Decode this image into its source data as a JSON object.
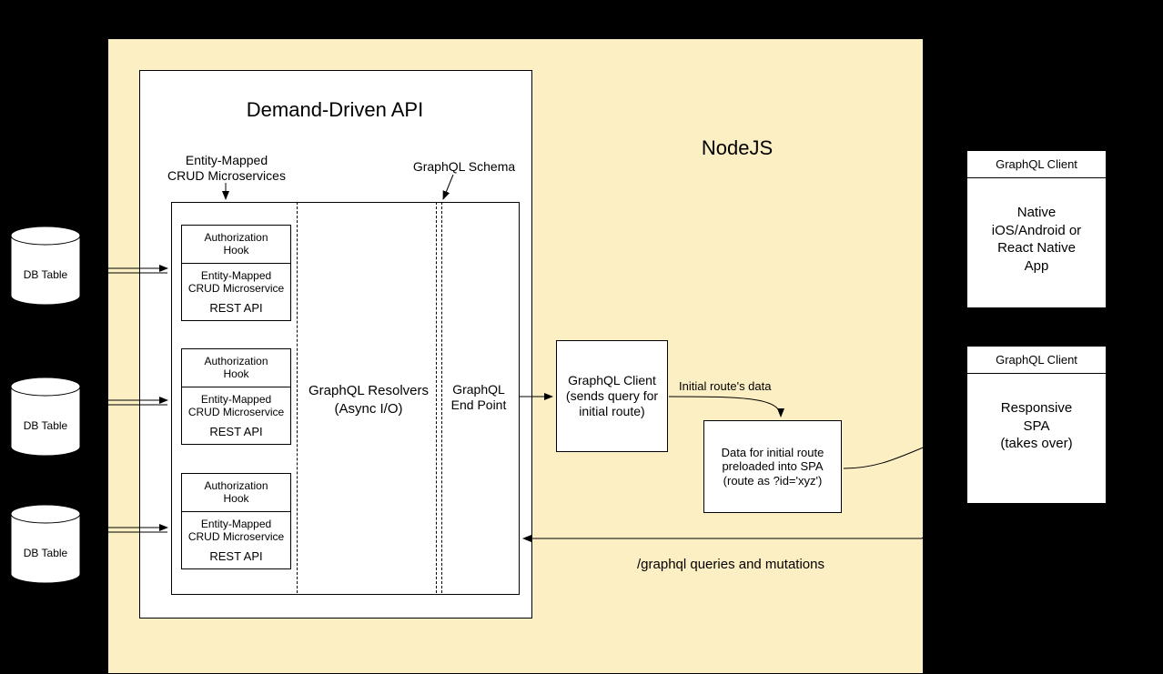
{
  "nodejs": {
    "label": "NodeJS"
  },
  "api": {
    "title": "Demand-Driven API",
    "entity_header": "Entity-Mapped\nCRUD Microservices",
    "schema_header": "GraphQL Schema",
    "resolvers": "GraphQL Resolvers\n(Async I/O)",
    "endpoint": "GraphQL\nEnd Point"
  },
  "microservice": {
    "auth": "Authorization\nHook",
    "crud": "Entity-Mapped\nCRUD Microservice",
    "rest": "REST API"
  },
  "db": {
    "label": "DB Table"
  },
  "gql_client_server": "GraphQL Client\n(sends query for\ninitial route)",
  "initial_route": "Initial route's data",
  "preload": "Data for initial route\npreloaded into SPA\n(route as ?id='xyz')",
  "queries_label": "/graphql queries and mutations",
  "right": {
    "gql_client": "GraphQL Client",
    "native": "Native\niOS/Android or\nReact Native\nApp",
    "spa": "Responsive\nSPA\n(takes over)"
  }
}
